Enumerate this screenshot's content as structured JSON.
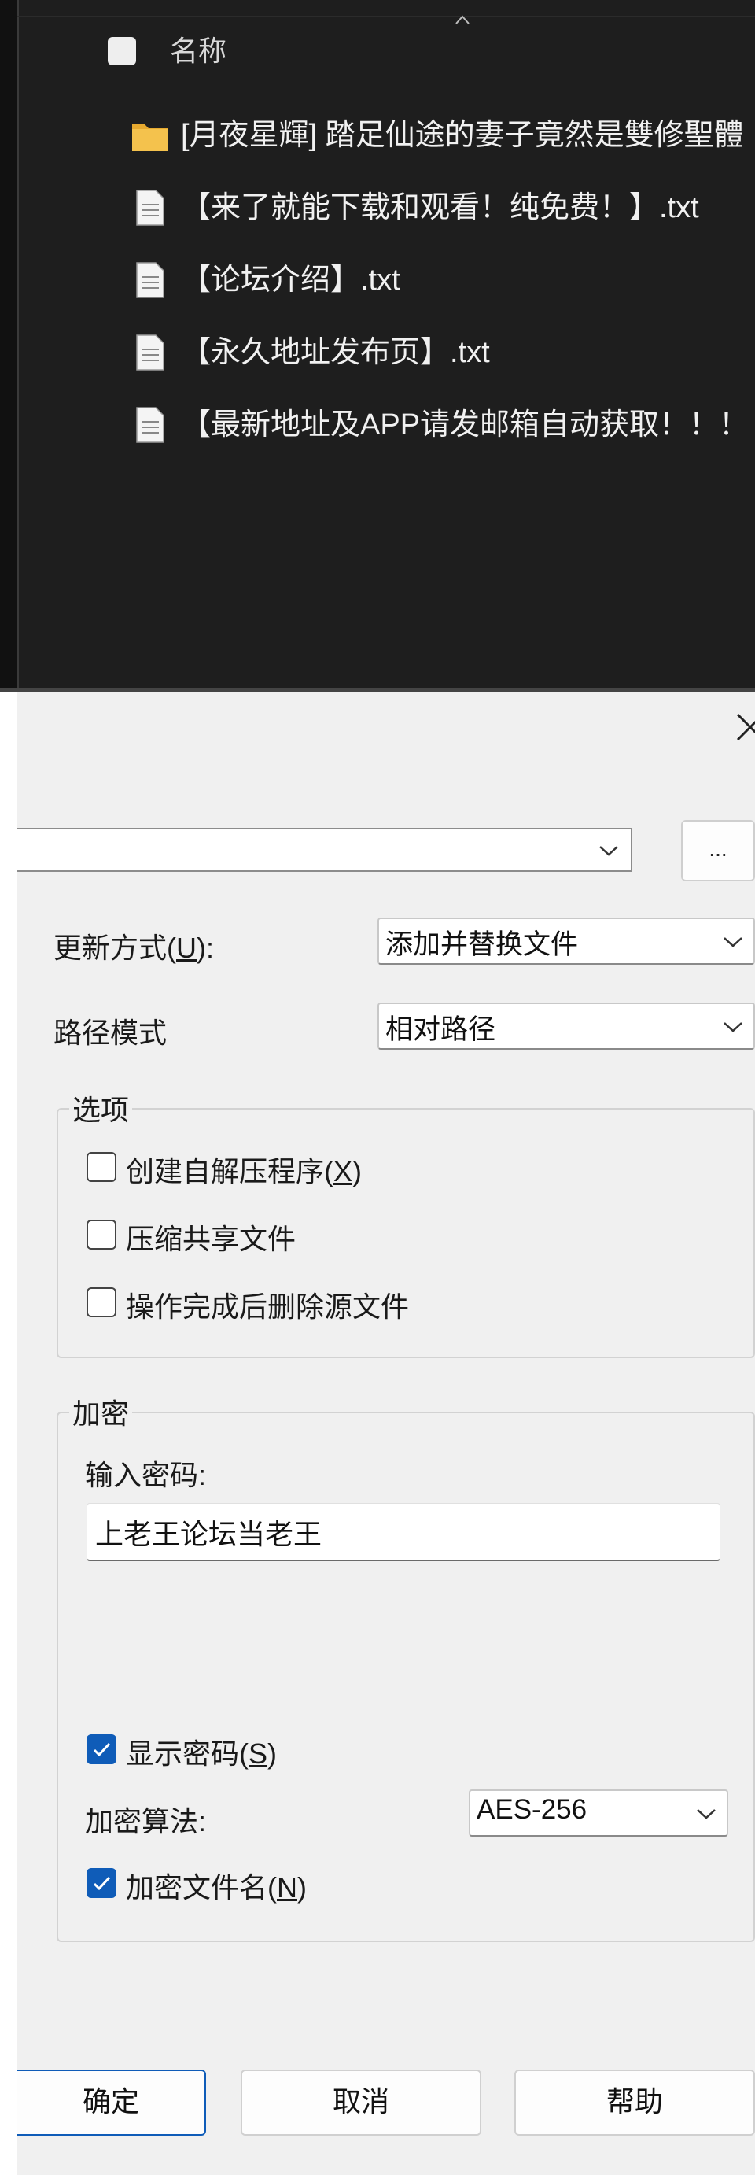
{
  "explorer": {
    "column_header": "名称",
    "items": [
      {
        "type": "folder",
        "name": "[月夜星輝] 踏足仙途的妻子竟然是雙修聖體"
      },
      {
        "type": "file",
        "name": "【来了就能下载和观看！纯免费！】.txt"
      },
      {
        "type": "file",
        "name": "【论坛介绍】.txt"
      },
      {
        "type": "file",
        "name": "【永久地址发布页】.txt"
      },
      {
        "type": "file",
        "name": "【最新地址及APP请发邮箱自动获取！！！"
      }
    ]
  },
  "dialog": {
    "browse_label": "...",
    "update_mode": {
      "label": "更新方式(",
      "key": "U",
      "suffix": "):",
      "value": "添加并替换文件"
    },
    "path_mode": {
      "label": "路径模式",
      "value": "相对路径"
    },
    "options": {
      "title": "选项",
      "sfx": {
        "label": "创建自解压程序(",
        "key": "X",
        "suffix": ")",
        "checked": false
      },
      "shared": {
        "label": "压缩共享文件",
        "checked": false
      },
      "delete": {
        "label": "操作完成后删除源文件",
        "checked": false
      }
    },
    "encryption": {
      "title": "加密",
      "password_label": "输入密码:",
      "password_value": "上老王论坛当老王",
      "show_password": {
        "label": "显示密码(",
        "key": "S",
        "suffix": ")",
        "checked": true
      },
      "method_label": "加密算法:",
      "method_value": "AES-256",
      "encrypt_names": {
        "label": "加密文件名(",
        "key": "N",
        "suffix": ")",
        "checked": true
      }
    },
    "buttons": {
      "ok": "确定",
      "cancel": "取消",
      "help": "帮助"
    }
  },
  "colors": {
    "explorer_bg": "#1e1e1e",
    "dialog_bg": "#f0f0f0",
    "accent": "#0f5cb8",
    "folder": "#f4c24d"
  }
}
